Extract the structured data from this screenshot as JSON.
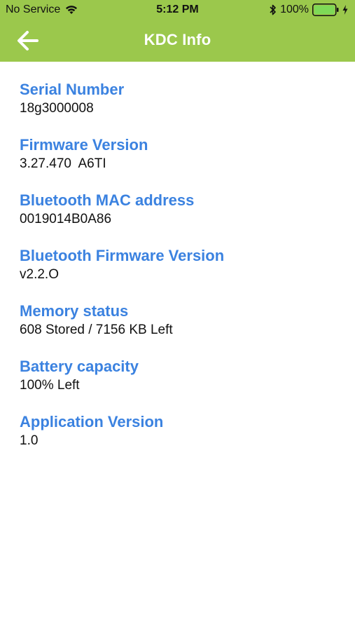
{
  "status_bar": {
    "carrier": "No Service",
    "time": "5:12 PM",
    "battery_percent": "100%",
    "battery_level": 1.0,
    "icons": [
      "wifi-icon",
      "bluetooth-icon",
      "battery-icon",
      "charging-icon"
    ]
  },
  "nav": {
    "title": "KDC Info",
    "back_icon": "arrow-left-icon"
  },
  "colors": {
    "header_bg": "#9bc84c",
    "label": "#3b82e0",
    "value": "#111111",
    "battery_fill": "#7ed957"
  },
  "items": [
    {
      "label": "Serial Number",
      "value": "18g3000008"
    },
    {
      "label": "Firmware Version",
      "value": "3.27.470  A6TI"
    },
    {
      "label": "Bluetooth MAC address",
      "value": "0019014B0A86"
    },
    {
      "label": "Bluetooth Firmware Version",
      "value": "v2.2.O"
    },
    {
      "label": "Memory status",
      "value": "608 Stored / 7156 KB Left"
    },
    {
      "label": "Battery capacity",
      "value": "100% Left"
    },
    {
      "label": "Application Version",
      "value": "1.0"
    }
  ]
}
